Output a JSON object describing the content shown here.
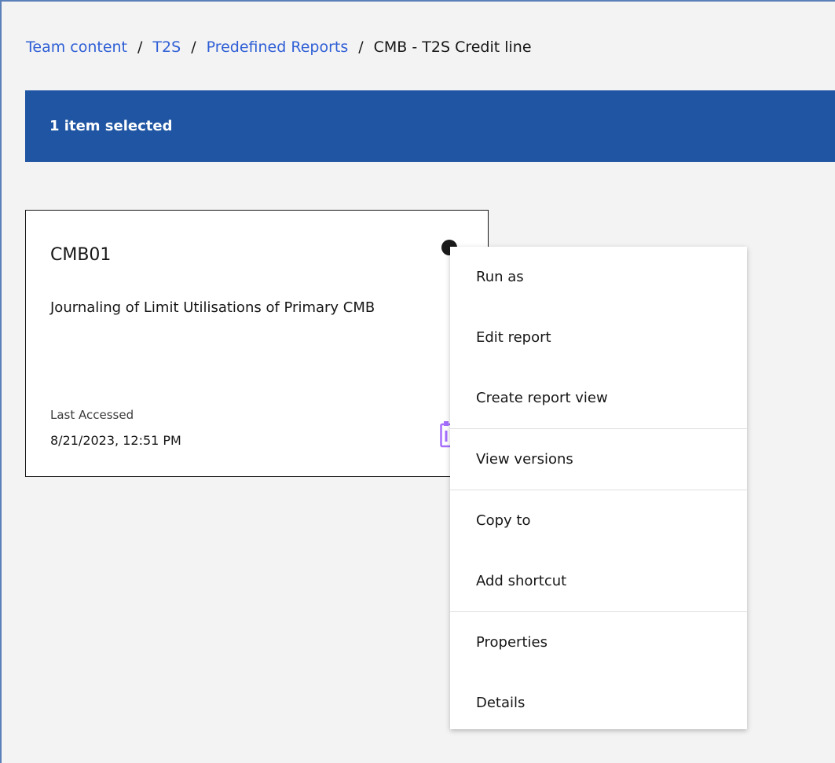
{
  "breadcrumb": {
    "items": [
      "Team content",
      "T2S",
      "Predefined Reports"
    ],
    "separator": "/",
    "current": "CMB - T2S Credit line"
  },
  "selection_bar": {
    "text": "1 item selected"
  },
  "card": {
    "title": "CMB01",
    "description": "Journaling of Limit Utilisations of Primary CMB",
    "last_accessed_label": "Last Accessed",
    "last_accessed_value": "8/21/2023, 12:51 PM",
    "icons": [
      "overflow-menu-icon",
      "report-icon"
    ]
  },
  "context_menu": {
    "items": [
      "Run as",
      "Edit report",
      "Create report view",
      "View versions",
      "Copy to",
      "Add shortcut",
      "Properties",
      "Details"
    ]
  },
  "colors": {
    "accent": "#1f55a2",
    "link": "#2f5fd6",
    "report_icon": "#a56eff"
  }
}
